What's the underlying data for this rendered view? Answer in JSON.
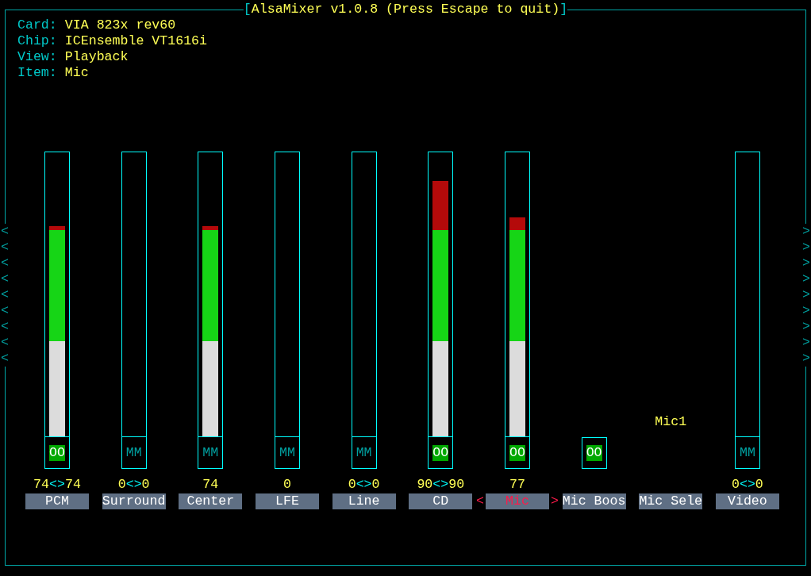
{
  "title": {
    "open": "[",
    "text": "AlsaMixer v1.0.8 (Press Escape to quit)",
    "close": "]"
  },
  "info": [
    {
      "label": "Card:",
      "value": "VIA 823x rev60"
    },
    {
      "label": "Chip:",
      "value": "ICEnsemble VT1616i"
    },
    {
      "label": "View:",
      "value": "Playback"
    },
    {
      "label": "Item:",
      "value": "Mic"
    }
  ],
  "scroll_left": [
    "<",
    "<",
    "<",
    "<",
    "<",
    "<",
    "<",
    "<",
    "<"
  ],
  "scroll_right": [
    ">",
    ">",
    ">",
    ">",
    ">",
    ">",
    ">",
    ">",
    ">"
  ],
  "selection_marks": {
    "left": "<",
    "right": ">"
  },
  "channels": [
    {
      "name": "PCM",
      "kind": "meter",
      "level": 0.74,
      "switch": {
        "text": "OO",
        "on": true
      },
      "reading": [
        "74",
        "<>",
        "74"
      ],
      "selected": false
    },
    {
      "name": "Surround",
      "kind": "meter",
      "level": 0,
      "switch": {
        "text": "MM",
        "on": false
      },
      "reading": [
        "0",
        "<>",
        "0"
      ],
      "selected": false
    },
    {
      "name": "Center",
      "kind": "meter",
      "level": 0.74,
      "switch": {
        "text": "MM",
        "on": false
      },
      "reading": [
        "74"
      ],
      "selected": false
    },
    {
      "name": "LFE",
      "kind": "meter",
      "level": 0,
      "switch": {
        "text": "MM",
        "on": false
      },
      "reading": [
        "0"
      ],
      "selected": false
    },
    {
      "name": "Line",
      "kind": "meter",
      "level": 0,
      "switch": {
        "text": "MM",
        "on": false
      },
      "reading": [
        "0",
        "<>",
        "0"
      ],
      "selected": false
    },
    {
      "name": "CD",
      "kind": "meter",
      "level": 0.9,
      "switch": {
        "text": "OO",
        "on": true
      },
      "reading": [
        "90",
        "<>",
        "90"
      ],
      "selected": false
    },
    {
      "name": "Mic",
      "kind": "meter",
      "level": 0.77,
      "switch": {
        "text": "OO",
        "on": true
      },
      "reading": [
        "77"
      ],
      "selected": true
    },
    {
      "name": "Mic Boos",
      "kind": "switch",
      "switch": {
        "text": "OO",
        "on": true
      },
      "selected": false
    },
    {
      "name": "Mic Sele",
      "kind": "enum",
      "value": "Mic1",
      "selected": false
    },
    {
      "name": "Video",
      "kind": "meter",
      "level": 0,
      "switch": {
        "text": "MM",
        "on": false
      },
      "reading": [
        "0",
        "<>",
        "0"
      ],
      "selected": false
    }
  ]
}
